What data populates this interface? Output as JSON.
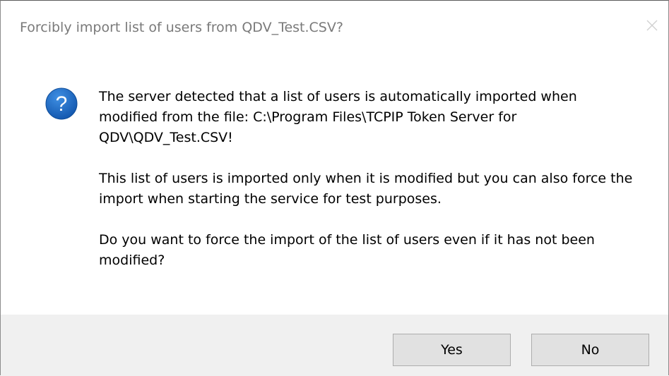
{
  "window": {
    "title": "Forcibly import list of users from QDV_Test.CSV?",
    "close_icon": "close-icon"
  },
  "message": {
    "icon": "question-icon",
    "paragraphs": [
      "The server detected that a list of users is automatically imported when modified from the file: C:\\Program Files\\TCPIP Token Server for QDV\\QDV_Test.CSV!",
      "This list of users is imported only when it is modified but you can also force the import when starting the service for test purposes.",
      "Do you want to force the import of the list of users even if it has not been modified?"
    ]
  },
  "buttons": {
    "yes_label": "Yes",
    "no_label": "No"
  },
  "colors": {
    "icon_blue": "#1e6fc9",
    "footer_bg": "#f0f0f0",
    "button_bg": "#e1e1e1",
    "button_border": "#adadad",
    "title_text": "#7a7a7a"
  }
}
